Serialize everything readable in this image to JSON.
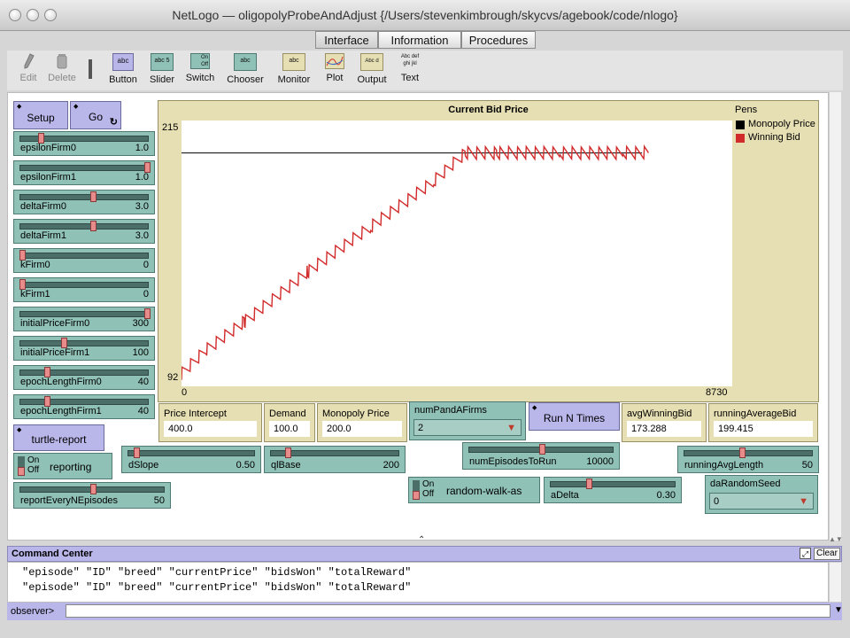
{
  "window": {
    "title": "NetLogo — oligopolyProbeAndAdjust {/Users/stevenkimbrough/skycvs/agebook/code/nlogo}"
  },
  "tabs": [
    {
      "label": "Interface"
    },
    {
      "label": "Information"
    },
    {
      "label": "Procedures"
    }
  ],
  "toolbar": {
    "edit": "Edit",
    "delete": "Delete",
    "button": "Button",
    "slider": "Slider",
    "switch": "Switch",
    "chooser": "Chooser",
    "monitor": "Monitor",
    "plot": "Plot",
    "output": "Output",
    "text": "Text",
    "icon_abc": "abc",
    "icon_abc5": "abc 5",
    "icon_on": "On",
    "icon_off": "Off",
    "icon_text": "Abc def ghi jkl",
    "icon_output": "Abc d"
  },
  "buttons": {
    "setup": "Setup",
    "go": "Go",
    "turtle_report": "turtle-report",
    "run_n_times": "Run N Times"
  },
  "sliders": [
    {
      "name": "epsilonFirm0",
      "value": "1.0",
      "level": 0.15
    },
    {
      "name": "epsilonFirm1",
      "value": "1.0",
      "level": 1.0
    },
    {
      "name": "deltaFirm0",
      "value": "3.0",
      "level": 0.57
    },
    {
      "name": "deltaFirm1",
      "value": "3.0",
      "level": 0.57
    },
    {
      "name": "kFirm0",
      "value": "0",
      "level": 0.0
    },
    {
      "name": "kFirm1",
      "value": "0",
      "level": 0.0
    },
    {
      "name": "initialPriceFirm0",
      "value": "300",
      "level": 1.0
    },
    {
      "name": "initialPriceFirm1",
      "value": "100",
      "level": 0.33
    },
    {
      "name": "epochLengthFirm0",
      "value": "40",
      "level": 0.2
    },
    {
      "name": "epochLengthFirm1",
      "value": "40",
      "level": 0.2
    },
    {
      "name": "reportEveryNEpisodes",
      "value": "50",
      "level": 0.5
    },
    {
      "name": "dSlope",
      "value": "0.50",
      "level": 0.05
    },
    {
      "name": "qlBase",
      "value": "200",
      "level": 0.12
    },
    {
      "name": "numEpisodesToRun",
      "value": "10000",
      "level": 0.5
    },
    {
      "name": "aDelta",
      "value": "0.30",
      "level": 0.3
    },
    {
      "name": "runningAvgLength",
      "value": "50",
      "level": 0.45
    }
  ],
  "monitors": {
    "price_intercept": {
      "name": "Price Intercept",
      "value": "400.0"
    },
    "demand": {
      "name": "Demand",
      "value": "100.0"
    },
    "monopoly_price": {
      "name": "Monopoly Price",
      "value": "200.0"
    },
    "avg_winning_bid": {
      "name": "avgWinningBid",
      "value": "173.288"
    },
    "running_average_bid": {
      "name": "runningAverageBid",
      "value": "199.415"
    }
  },
  "choosers": {
    "num_pand_a_firms": {
      "name": "numPandAFirms",
      "value": "2"
    },
    "da_random_seed": {
      "name": "daRandomSeed",
      "value": "0"
    }
  },
  "switches": {
    "reporting": {
      "name": "reporting",
      "on": "On",
      "off": "Off",
      "state": "off"
    },
    "random_walk_as": {
      "name": "random-walk-as",
      "on": "On",
      "off": "Off",
      "state": "off"
    }
  },
  "plot": {
    "pens_label": "Pens",
    "pen_colors": {
      "monopoly": "#000000",
      "winning": "#d22b2b"
    }
  },
  "chart_data": {
    "type": "line",
    "title": "Current Bid Price",
    "xlabel": "",
    "ylabel": "",
    "xlim": [
      0,
      8730
    ],
    "ylim": [
      92,
      215
    ],
    "xmin_label": "0",
    "xmax_label": "8730",
    "ymin_label": "92",
    "ymax_label": "215",
    "legend_position": "right",
    "series": [
      {
        "name": "Monopoly Price",
        "color": "#000000",
        "x": [
          0,
          7300
        ],
        "y": [
          200,
          200
        ]
      },
      {
        "name": "Winning Bid",
        "color": "#d22b2b",
        "x": [
          0,
          400,
          1000,
          2000,
          3000,
          4000,
          4500,
          5000,
          6000,
          7000,
          7400
        ],
        "y": [
          98,
          109,
          122,
          145,
          166,
          187,
          200,
          200,
          200,
          200,
          200
        ],
        "noise_band": 3
      }
    ]
  },
  "command_center": {
    "title": "Command Center",
    "clear": "Clear",
    "lines": [
      "\"episode\" \"ID\" \"breed\" \"currentPrice\" \"bidsWon\" \"totalReward\"",
      "\"episode\" \"ID\" \"breed\" \"currentPrice\" \"bidsWon\" \"totalReward\""
    ],
    "prompt": "observer>"
  }
}
